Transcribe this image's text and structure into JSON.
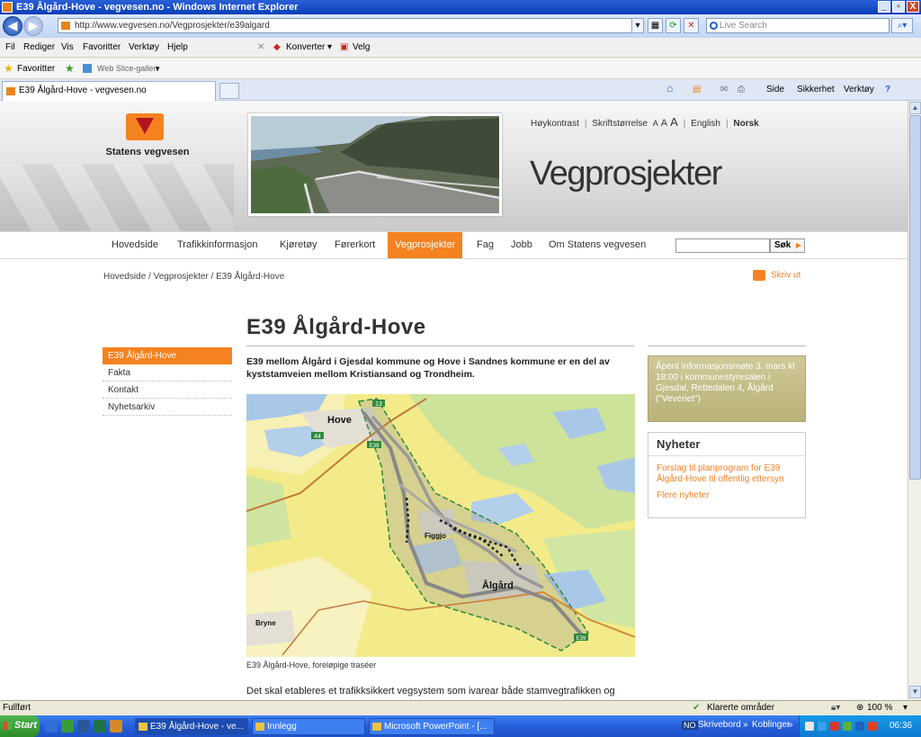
{
  "window": {
    "title": "E39 Ålgård-Hove - vegvesen.no - Windows Internet Explorer",
    "min": "_",
    "max": "▫",
    "close": "X"
  },
  "addressbar": {
    "url": "http://www.vegvesen.no/Vegprosjekter/e39algard",
    "search_placeholder": "Live Search"
  },
  "menubar": {
    "items": [
      "Fil",
      "Rediger",
      "Vis",
      "Favoritter",
      "Verktøy",
      "Hjelp"
    ],
    "konverter": "Konverter",
    "velg": "Velg"
  },
  "favbar": {
    "favorites": "Favoritter",
    "webslice": "Web Slice-galleri"
  },
  "tabbar": {
    "tab_title": "E39 Ålgård-Hove - vegvesen.no",
    "commands": [
      "Side",
      "Sikkerhet",
      "Verktøy"
    ]
  },
  "site": {
    "logo_text": "Statens vegvesen",
    "title": "Vegprosjekter",
    "toplinks": {
      "contrast": "Høykontrast",
      "fontsize": "Skriftstørrelse",
      "a_small": "A",
      "a_medium": "A",
      "a_large": "A",
      "english": "English",
      "norsk": "Norsk"
    },
    "nav": [
      "Hovedside",
      "Trafikkinformasjon",
      "Kjøretøy",
      "Førerkort",
      "Vegprosjekter",
      "Fag",
      "Jobb",
      "Om Statens vegvesen"
    ],
    "nav_active_index": 4,
    "search_button": "Søk",
    "breadcrumb": [
      "Hovedside",
      "Vegprosjekter",
      "E39 Ålgård-Hove"
    ],
    "breadcrumb_sep": "/",
    "print": "Skriv ut"
  },
  "sidenav": {
    "items": [
      "E39 Ålgård-Hove",
      "Fakta",
      "Kontakt",
      "Nyhetsarkiv"
    ],
    "active_index": 0
  },
  "article": {
    "heading": "E39 Ålgård-Hove",
    "lead": "E39 mellom Ålgård i Gjesdal kommune og Hove i Sandnes kommune er en del av kyststamveien mellom Kristiansand og Trondheim.",
    "map_labels": {
      "hove": "Hove",
      "figgjo": "Figgjo",
      "algard": "Ålgård",
      "bryne": "Bryne",
      "r13": "13",
      "r44": "44",
      "e39a": "E39",
      "e39b": "E39"
    },
    "caption": "E39 Ålgård-Hove, foreløpige traséer",
    "body_start": "Det skal etableres et trafikksikkert vegsystem som ivarear både stamvegtrafikken og"
  },
  "sidebar": {
    "info": "Åpent informasjonsmøte 3. mars kl 18:00 i kommunestyresalen i Gjesdal, Rettedalen 4, Ålgård (\"Veveriet\")",
    "news_heading": "Nyheter",
    "news_item": "Forslag til planprogram for E39 Ålgård-Hove til offentlig ettersyn",
    "news_more": "Flere nyheter"
  },
  "statusbar": {
    "text": "Fullført",
    "zone": "Klarerte områder",
    "zoom": "100 %"
  },
  "taskbar": {
    "start": "Start",
    "buttons": [
      "E39 Ålgård-Hove - ve...",
      "Innlegg",
      "Microsoft PowerPoint - [..."
    ],
    "desktop": "Skrivebord",
    "links": "Koblinger",
    "lang": "NO",
    "clock": "06:36"
  },
  "colors": {
    "brand_orange": "#f58220",
    "info_olive": "#b9b279"
  }
}
